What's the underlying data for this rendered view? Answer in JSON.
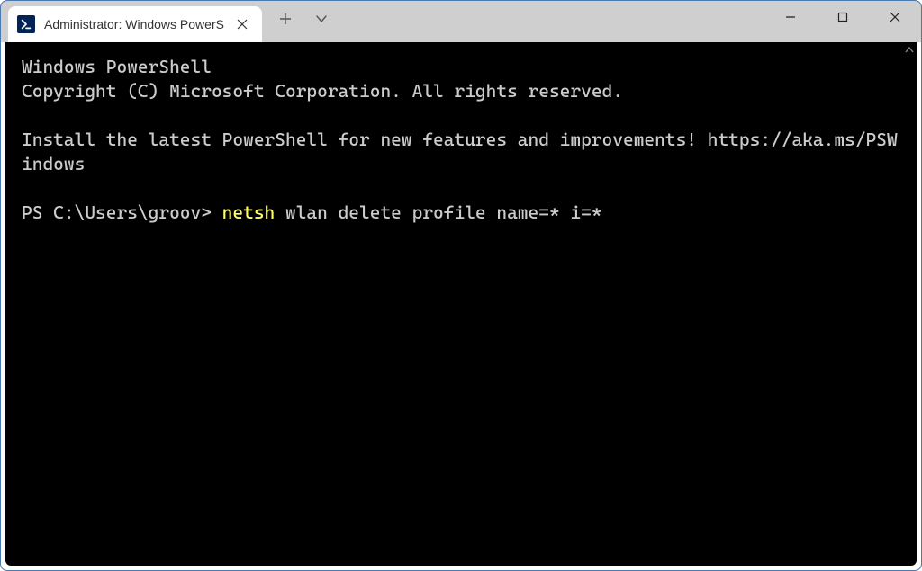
{
  "titlebar": {
    "tab_title": "Administrator: Windows PowerS",
    "icon_name": "powershell-icon"
  },
  "terminal": {
    "line1": "Windows PowerShell",
    "line2": "Copyright (C) Microsoft Corporation. All rights reserved.",
    "line3": "Install the latest PowerShell for new features and improvements! https://aka.ms/PSWindows",
    "prompt_prefix": "PS C:\\Users\\groov> ",
    "cmd_highlight": "netsh",
    "cmd_rest": " wlan delete profile name=* i=*"
  }
}
